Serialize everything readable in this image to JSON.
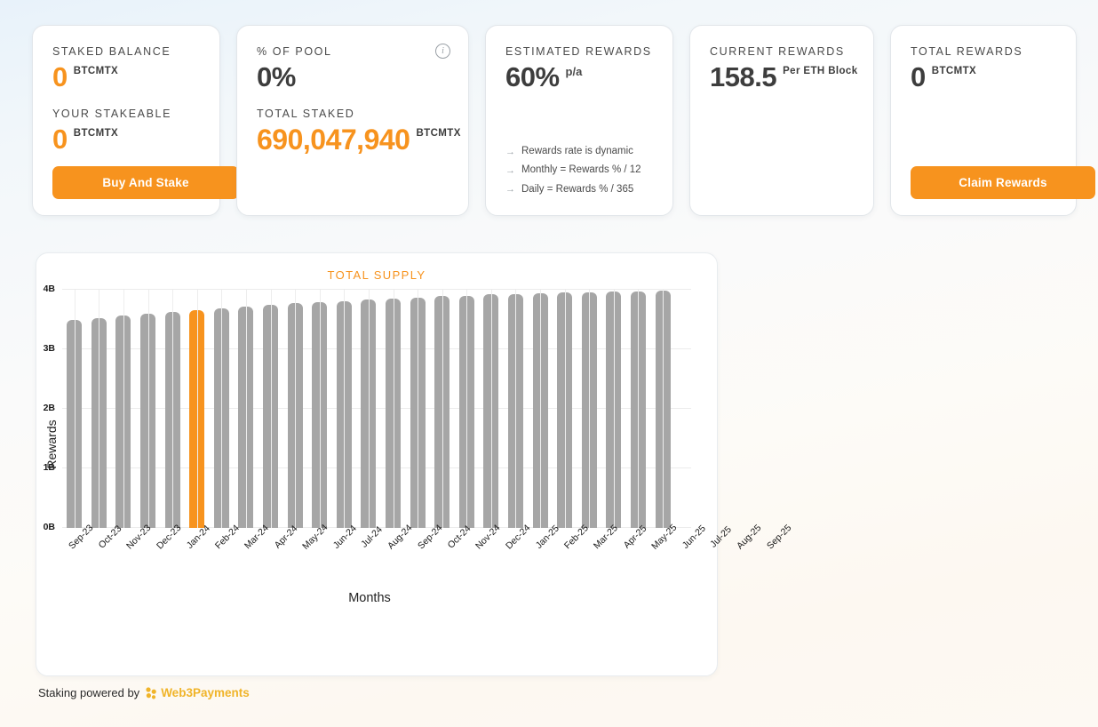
{
  "cards": [
    {
      "id": "staked-balance",
      "label": "STAKED BALANCE",
      "value": "0",
      "unit": "BTCMTX",
      "sub_label": "YOUR STAKEABLE",
      "sub_value": "0",
      "sub_unit": "BTCMTX",
      "button": "Buy And Stake"
    },
    {
      "id": "percent-of-pool",
      "label": "% OF POOL",
      "value": "0%",
      "sub_label": "TOTAL STAKED",
      "sub_value": "690,047,940",
      "sub_unit": "BTCMTX",
      "info_icon": "info-icon"
    },
    {
      "id": "estimated-rewards",
      "label": "ESTIMATED REWARDS",
      "value": "60%",
      "suffix": "p/a",
      "notes": [
        "Rewards rate is dynamic",
        "Monthly = Rewards % / 12",
        "Daily = Rewards % / 365"
      ]
    },
    {
      "id": "current-rewards",
      "label": "CURRENT REWARDS",
      "value": "158.5",
      "unit": "Per ETH Block"
    },
    {
      "id": "total-rewards",
      "label": "TOTAL REWARDS",
      "value": "0",
      "unit": "BTCMTX",
      "button": "Claim Rewards"
    }
  ],
  "footer": {
    "text": "Staking powered by",
    "brand": "Web3Payments"
  },
  "colors": {
    "accent_orange": "#f7931e",
    "bar_gray": "#a6a6a6",
    "brand_yellow": "#f0b429"
  },
  "chart_data": {
    "type": "bar",
    "title": "TOTAL SUPPLY",
    "xlabel": "Months",
    "ylabel": "Rewards",
    "ylim": [
      0,
      4000000000
    ],
    "ytick_labels": [
      "0B",
      "1B",
      "2B",
      "3B",
      "4B"
    ],
    "ytick_values": [
      0,
      1000000000,
      2000000000,
      3000000000,
      4000000000
    ],
    "grid": true,
    "legend": "none",
    "highlight_category": "Feb-24",
    "highlight_color": "#f7931e",
    "bar_color": "#a6a6a6",
    "categories": [
      "Sep-23",
      "Oct-23",
      "Nov-23",
      "Dec-23",
      "Jan-24",
      "Feb-24",
      "Mar-24",
      "Apr-24",
      "May-24",
      "Jun-24",
      "Jul-24",
      "Aug-24",
      "Sep-24",
      "Oct-24",
      "Nov-24",
      "Dec-24",
      "Jan-25",
      "Feb-25",
      "Mar-25",
      "Apr-25",
      "May-25",
      "Jun-25",
      "Jul-25",
      "Aug-25",
      "Sep-25"
    ],
    "values": [
      3.49,
      3.53,
      3.56,
      3.59,
      3.62,
      3.65,
      3.68,
      3.71,
      3.74,
      3.77,
      3.79,
      3.81,
      3.83,
      3.85,
      3.87,
      3.89,
      3.9,
      3.92,
      3.93,
      3.94,
      3.95,
      3.96,
      3.97,
      3.975,
      3.98
    ],
    "value_unit": "B"
  }
}
